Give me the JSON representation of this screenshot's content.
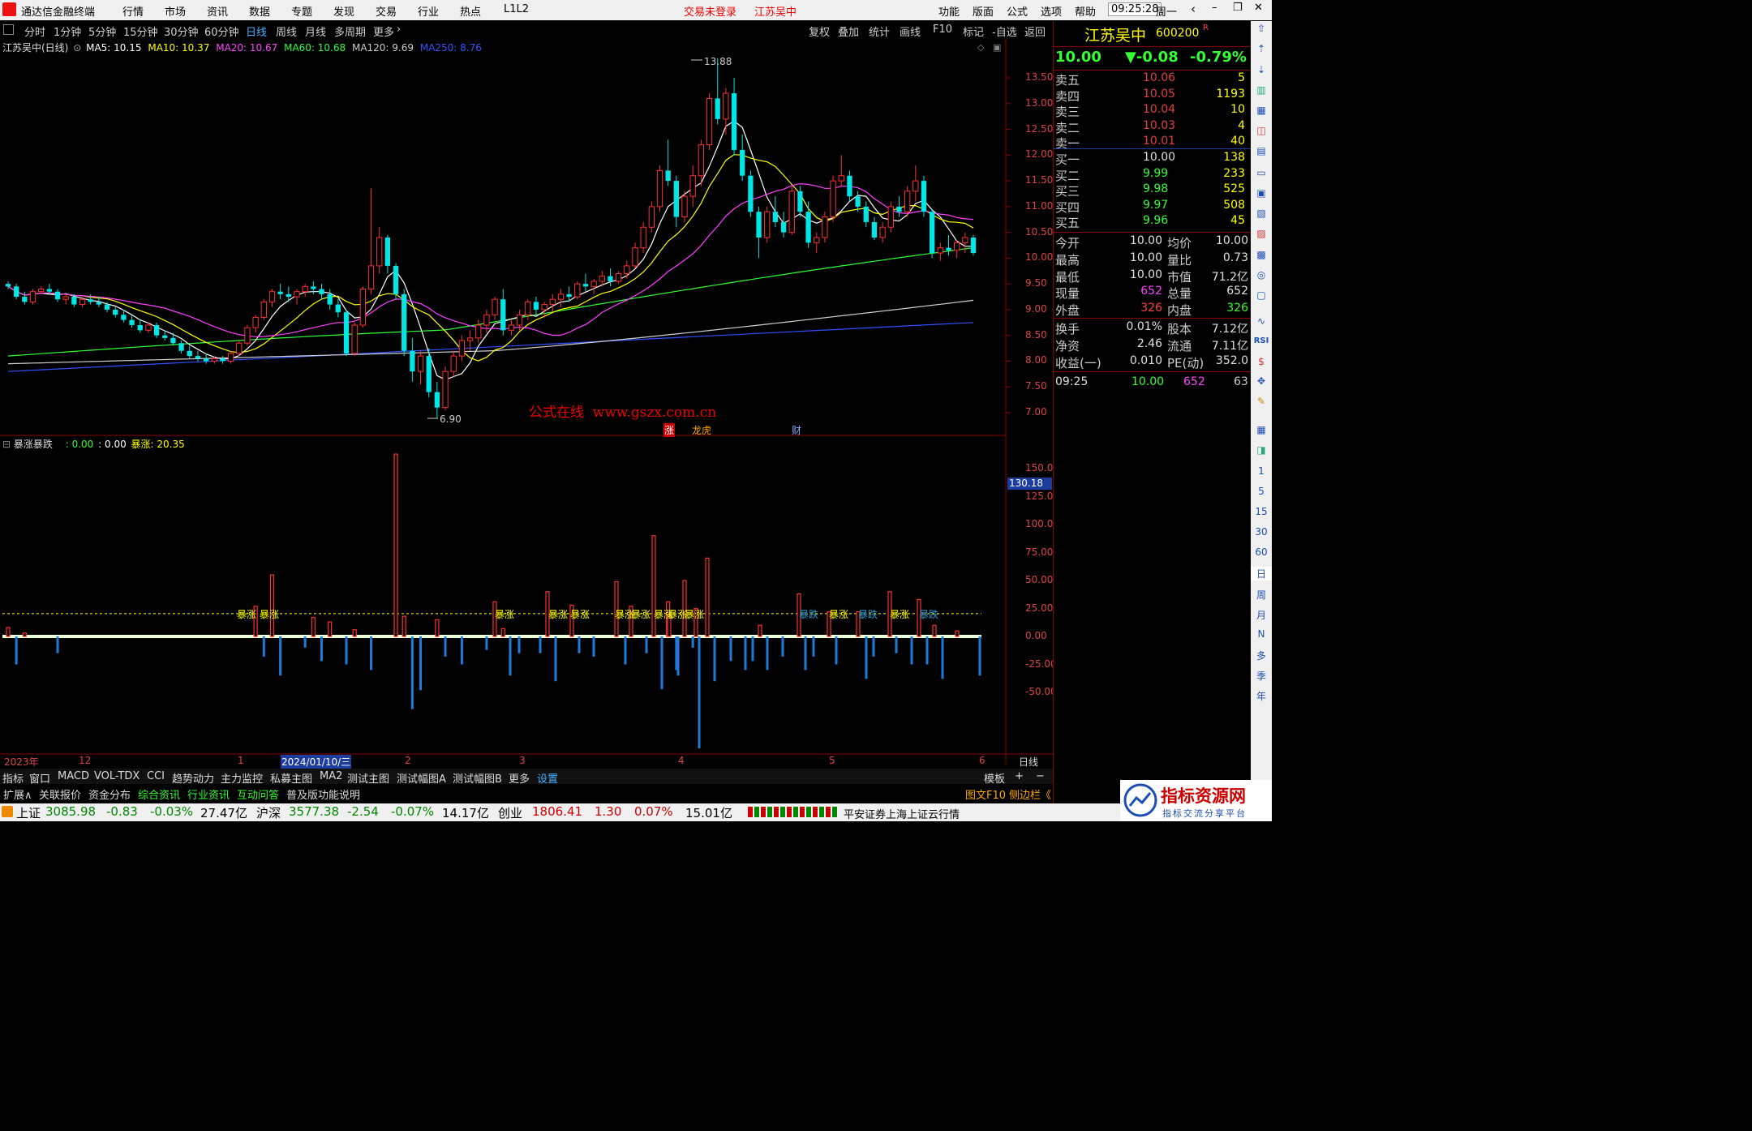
{
  "menubar": {
    "app_title": "通达信金融终端",
    "menus": [
      "行情",
      "市场",
      "资讯",
      "数据",
      "专题",
      "发现",
      "交易",
      "行业",
      "热点",
      "L1L2"
    ],
    "trade_status": "交易未登录",
    "stock_name": "江苏吴中",
    "right_menus": [
      "功能",
      "版面",
      "公式",
      "选项",
      "帮助"
    ],
    "time": "09:25:28",
    "weekday": "周一"
  },
  "period_tabs": [
    "分时",
    "1分钟",
    "5分钟",
    "15分钟",
    "30分钟",
    "60分钟",
    "日线",
    "周线",
    "月线",
    "多周期",
    "更多"
  ],
  "active_period": "日线",
  "chart_tools": [
    "复权",
    "叠加",
    "统计",
    "画线",
    "F10",
    "标记",
    "-自选",
    "返回"
  ],
  "ma_legend": {
    "title": "江苏吴中(日线)",
    "items": [
      {
        "label": "MA5: 10.15",
        "color": "#ffffff"
      },
      {
        "label": "MA10: 10.37",
        "color": "#ffff00"
      },
      {
        "label": "MA20: 10.67",
        "color": "#ff40ff"
      },
      {
        "label": "MA60: 10.68",
        "color": "#30ff30"
      },
      {
        "label": "MA120: 9.69",
        "color": "#d0d0d0"
      },
      {
        "label": "MA250: 8.76",
        "color": "#3050ff"
      }
    ]
  },
  "price_axis": [
    "13.50",
    "13.00",
    "12.50",
    "12.00",
    "11.50",
    "11.00",
    "10.50",
    "10.00",
    "9.50",
    "9.00",
    "8.50",
    "8.00",
    "7.50",
    "7.00"
  ],
  "high_label": "13.88",
  "low_label": "6.90",
  "watermark": "公式在线  www.gszx.com.cn",
  "event_tags": [
    "涨",
    "龙虎",
    "财"
  ],
  "indicator": {
    "name": "暴涨暴跌",
    "v1": ": 0.00",
    "v2": ": 0.00",
    "v3_label": "暴涨: 20.35",
    "axis": [
      "150.0",
      "125.0",
      "100.0",
      "75.00",
      "50.00",
      "25.00",
      "0.00",
      "-25.00",
      "-50.00"
    ],
    "current_tag": "130.18",
    "bar_labels": [
      "暴涨",
      "暴涨",
      "暴涨",
      "暴涨",
      "暴涨",
      "暴涨",
      "暴涨",
      "暴涨",
      "暴涨",
      "暴涨",
      "暴跌",
      "暴涨",
      "暴跌",
      "暴涨",
      "暴跌"
    ]
  },
  "date_axis": [
    "2023年",
    "12",
    "1",
    "2024/01/10/三",
    "2",
    "3",
    "4",
    "5",
    "6"
  ],
  "period_label": "日线",
  "indicator_tabs": [
    "指标",
    "窗口",
    "MACD",
    "VOL-TDX",
    "CCI",
    "趋势动力",
    "主力监控",
    "私募主图",
    "MA2",
    "测试主图",
    "测试幅图A",
    "测试幅图B",
    "更多",
    "设置"
  ],
  "template_tab": "模板",
  "bottom_tabs": [
    "扩展∧",
    "关联报价",
    "资金分布",
    "综合资讯",
    "行业资讯",
    "互动问答",
    "普及版功能说明"
  ],
  "bottom_right": [
    "图文F10",
    "侧边栏《",
    "笔",
    "价",
    "细"
  ],
  "quote": {
    "name": "江苏吴中",
    "code": "600200",
    "flag": "R",
    "price": "10.00",
    "change": "▼-0.08",
    "pct": "-0.79%",
    "asks": [
      {
        "label": "卖五",
        "price": "10.06",
        "vol": "5"
      },
      {
        "label": "卖四",
        "price": "10.05",
        "vol": "1193"
      },
      {
        "label": "卖三",
        "price": "10.04",
        "vol": "10"
      },
      {
        "label": "卖二",
        "price": "10.03",
        "vol": "4"
      },
      {
        "label": "卖一",
        "price": "10.01",
        "vol": "40"
      }
    ],
    "bids": [
      {
        "label": "买一",
        "price": "10.00",
        "vol": "138"
      },
      {
        "label": "买二",
        "price": "9.99",
        "vol": "233"
      },
      {
        "label": "买三",
        "price": "9.98",
        "vol": "525"
      },
      {
        "label": "买四",
        "price": "9.97",
        "vol": "508"
      },
      {
        "label": "买五",
        "price": "9.96",
        "vol": "45"
      }
    ],
    "stats": [
      {
        "l1": "今开",
        "v1": "10.00",
        "l2": "均价",
        "v2": "10.00",
        "c1": "#e0e0e0",
        "c2": "#e0e0e0"
      },
      {
        "l1": "最高",
        "v1": "10.00",
        "l2": "量比",
        "v2": "0.73",
        "c1": "#e0e0e0",
        "c2": "#e0e0e0"
      },
      {
        "l1": "最低",
        "v1": "10.00",
        "l2": "市值",
        "v2": "71.2亿",
        "c1": "#e0e0e0",
        "c2": "#e0e0e0"
      },
      {
        "l1": "现量",
        "v1": "652",
        "l2": "总量",
        "v2": "652",
        "c1": "#ff40ff",
        "c2": "#e0e0e0"
      },
      {
        "l1": "外盘",
        "v1": "326",
        "l2": "内盘",
        "v2": "326",
        "c1": "#ff4040",
        "c2": "#30ff30"
      }
    ],
    "fund": [
      {
        "l1": "换手",
        "v1": "0.01%",
        "l2": "股本",
        "v2": "7.12亿"
      },
      {
        "l1": "净资",
        "v1": "2.46",
        "l2": "流通",
        "v2": "7.11亿"
      },
      {
        "l1": "收益(一)",
        "v1": "0.010",
        "l2": "PE(动)",
        "v2": "352.0"
      }
    ],
    "tick": {
      "time": "09:25",
      "price": "10.00",
      "vol": "652",
      "num": "63"
    }
  },
  "side_toolbar": [
    "RSI",
    "1",
    "5",
    "15",
    "30",
    "60",
    "日",
    "周",
    "月",
    "N",
    "多",
    "季",
    "年"
  ],
  "statusbar": {
    "indices": [
      {
        "name": "上证",
        "value": "3085.98",
        "chg": "-0.83",
        "pct": "-0.03%",
        "amt": "27.47亿"
      },
      {
        "name": "沪深",
        "value": "3577.38",
        "chg": "-2.54",
        "pct": "-0.07%",
        "amt": "14.17亿"
      },
      {
        "name": "创业",
        "value": "1806.41",
        "chg": "1.30",
        "pct": "0.07%",
        "amt": "15.01亿"
      }
    ],
    "feed": "平安证券上海上证云行情",
    "logo_text": "指标资源网",
    "logo_sub": "指标交流分享平台"
  },
  "chart_data": {
    "type": "candlestick",
    "title": "江苏吴中(日线)",
    "ylim": [
      6.9,
      13.88
    ],
    "note": "approximate OHLC read from chart",
    "candles": [
      [
        9.5,
        9.55,
        9.4,
        9.45
      ],
      [
        9.45,
        9.5,
        9.2,
        9.25
      ],
      [
        9.25,
        9.35,
        9.1,
        9.15
      ],
      [
        9.15,
        9.4,
        9.1,
        9.35
      ],
      [
        9.35,
        9.45,
        9.3,
        9.4
      ],
      [
        9.4,
        9.5,
        9.3,
        9.35
      ],
      [
        9.35,
        9.4,
        9.15,
        9.2
      ],
      [
        9.2,
        9.3,
        9.1,
        9.25
      ],
      [
        9.25,
        9.3,
        9.05,
        9.1
      ],
      [
        9.1,
        9.25,
        9.05,
        9.2
      ],
      [
        9.2,
        9.3,
        9.1,
        9.15
      ],
      [
        9.15,
        9.25,
        9.05,
        9.1
      ],
      [
        9.1,
        9.15,
        8.95,
        9.0
      ],
      [
        9.0,
        9.05,
        8.85,
        8.9
      ],
      [
        8.9,
        9.0,
        8.75,
        8.8
      ],
      [
        8.8,
        8.9,
        8.65,
        8.7
      ],
      [
        8.7,
        8.8,
        8.55,
        8.6
      ],
      [
        8.6,
        8.75,
        8.55,
        8.7
      ],
      [
        8.7,
        8.75,
        8.45,
        8.5
      ],
      [
        8.5,
        8.6,
        8.4,
        8.45
      ],
      [
        8.45,
        8.55,
        8.3,
        8.35
      ],
      [
        8.35,
        8.4,
        8.15,
        8.2
      ],
      [
        8.2,
        8.3,
        8.05,
        8.1
      ],
      [
        8.1,
        8.2,
        8.0,
        8.05
      ],
      [
        8.05,
        8.15,
        7.95,
        8.0
      ],
      [
        8.0,
        8.1,
        7.95,
        8.05
      ],
      [
        8.05,
        8.1,
        7.95,
        8.0
      ],
      [
        8.0,
        8.2,
        7.95,
        8.15
      ],
      [
        8.15,
        8.4,
        8.1,
        8.35
      ],
      [
        8.35,
        8.7,
        8.3,
        8.65
      ],
      [
        8.65,
        8.9,
        8.55,
        8.85
      ],
      [
        8.85,
        9.2,
        8.8,
        9.15
      ],
      [
        9.15,
        9.4,
        9.05,
        9.35
      ],
      [
        9.35,
        9.5,
        9.2,
        9.3
      ],
      [
        9.3,
        9.45,
        9.15,
        9.25
      ],
      [
        9.25,
        9.4,
        9.1,
        9.35
      ],
      [
        9.35,
        9.5,
        9.25,
        9.45
      ],
      [
        9.45,
        9.55,
        9.3,
        9.4
      ],
      [
        9.4,
        9.5,
        9.2,
        9.3
      ],
      [
        9.3,
        9.4,
        9.0,
        9.1
      ],
      [
        9.1,
        9.2,
        8.85,
        8.95
      ],
      [
        8.95,
        9.0,
        8.1,
        8.15
      ],
      [
        8.15,
        8.75,
        8.1,
        8.7
      ],
      [
        8.7,
        9.45,
        8.65,
        9.4
      ],
      [
        9.4,
        11.35,
        9.3,
        9.85
      ],
      [
        9.85,
        10.6,
        9.7,
        10.4
      ],
      [
        10.4,
        10.45,
        9.7,
        9.85
      ],
      [
        9.85,
        9.9,
        9.2,
        9.3
      ],
      [
        9.3,
        9.4,
        8.1,
        8.2
      ],
      [
        8.2,
        8.45,
        7.6,
        7.8
      ],
      [
        7.8,
        8.2,
        7.55,
        8.1
      ],
      [
        8.1,
        8.25,
        7.3,
        7.4
      ],
      [
        7.4,
        7.6,
        6.9,
        7.1
      ],
      [
        7.1,
        7.9,
        7.05,
        7.8
      ],
      [
        7.8,
        8.2,
        7.7,
        8.1
      ],
      [
        8.1,
        8.5,
        8.0,
        8.4
      ],
      [
        8.4,
        8.6,
        8.2,
        8.45
      ],
      [
        8.45,
        8.8,
        8.35,
        8.7
      ],
      [
        8.7,
        9.0,
        8.55,
        8.9
      ],
      [
        8.9,
        9.25,
        8.8,
        9.2
      ],
      [
        9.2,
        9.4,
        8.5,
        8.6
      ],
      [
        8.6,
        8.8,
        8.5,
        8.7
      ],
      [
        8.7,
        9.0,
        8.6,
        8.9
      ],
      [
        8.9,
        9.2,
        8.8,
        9.15
      ],
      [
        9.15,
        9.25,
        8.9,
        9.0
      ],
      [
        9.0,
        9.15,
        8.85,
        9.1
      ],
      [
        9.1,
        9.3,
        8.95,
        9.2
      ],
      [
        9.2,
        9.4,
        9.05,
        9.3
      ],
      [
        9.3,
        9.45,
        9.15,
        9.25
      ],
      [
        9.25,
        9.55,
        9.2,
        9.5
      ],
      [
        9.5,
        9.7,
        9.35,
        9.45
      ],
      [
        9.45,
        9.6,
        9.3,
        9.55
      ],
      [
        9.55,
        9.75,
        9.45,
        9.65
      ],
      [
        9.65,
        9.8,
        9.45,
        9.55
      ],
      [
        9.55,
        9.75,
        9.5,
        9.7
      ],
      [
        9.7,
        9.95,
        9.6,
        9.85
      ],
      [
        9.85,
        10.3,
        9.8,
        10.2
      ],
      [
        10.2,
        10.7,
        10.1,
        10.6
      ],
      [
        10.6,
        11.1,
        10.5,
        11.0
      ],
      [
        11.0,
        11.8,
        10.9,
        11.7
      ],
      [
        11.7,
        12.3,
        11.4,
        11.5
      ],
      [
        11.5,
        11.6,
        10.6,
        10.8
      ],
      [
        10.8,
        11.3,
        10.7,
        11.2
      ],
      [
        11.2,
        11.8,
        11.0,
        11.6
      ],
      [
        11.6,
        12.3,
        11.4,
        12.2
      ],
      [
        12.2,
        13.2,
        12.1,
        13.1
      ],
      [
        13.1,
        13.88,
        12.6,
        12.7
      ],
      [
        12.7,
        13.3,
        12.4,
        13.2
      ],
      [
        13.2,
        13.5,
        12.0,
        12.1
      ],
      [
        12.1,
        12.4,
        11.5,
        11.6
      ],
      [
        11.6,
        11.7,
        10.8,
        10.9
      ],
      [
        10.9,
        11.0,
        10.0,
        10.4
      ],
      [
        10.4,
        11.0,
        10.3,
        10.9
      ],
      [
        10.9,
        11.2,
        10.6,
        10.7
      ],
      [
        10.7,
        10.9,
        10.4,
        10.5
      ],
      [
        10.5,
        11.4,
        10.45,
        11.3
      ],
      [
        11.3,
        11.4,
        10.8,
        10.9
      ],
      [
        10.9,
        11.1,
        10.2,
        10.3
      ],
      [
        10.3,
        10.5,
        10.1,
        10.4
      ],
      [
        10.4,
        10.9,
        10.3,
        10.8
      ],
      [
        10.8,
        11.6,
        10.7,
        11.5
      ],
      [
        11.5,
        12.0,
        11.4,
        11.6
      ],
      [
        11.6,
        11.7,
        11.1,
        11.2
      ],
      [
        11.2,
        11.3,
        10.9,
        11.0
      ],
      [
        11.0,
        11.1,
        10.6,
        10.7
      ],
      [
        10.7,
        10.8,
        10.35,
        10.4
      ],
      [
        10.4,
        10.7,
        10.3,
        10.6
      ],
      [
        10.6,
        11.1,
        10.5,
        11.0
      ],
      [
        11.0,
        11.2,
        10.8,
        10.9
      ],
      [
        10.9,
        11.4,
        10.8,
        11.3
      ],
      [
        11.3,
        11.8,
        11.1,
        11.5
      ],
      [
        11.5,
        11.6,
        10.8,
        10.9
      ],
      [
        10.9,
        10.95,
        10.0,
        10.1
      ],
      [
        10.1,
        10.3,
        9.95,
        10.2
      ],
      [
        10.2,
        10.45,
        10.05,
        10.15
      ],
      [
        10.15,
        10.35,
        10.0,
        10.3
      ],
      [
        10.3,
        10.5,
        10.1,
        10.4
      ],
      [
        10.4,
        10.45,
        10.05,
        10.1
      ]
    ],
    "ma_series": [
      "MA5",
      "MA10",
      "MA20",
      "MA60",
      "MA120",
      "MA250"
    ],
    "indicator_bars": {
      "name": "暴涨暴跌",
      "threshold": 20.35,
      "values": [
        8,
        -25,
        3,
        0,
        0,
        0,
        -15,
        0,
        0,
        0,
        0,
        0,
        0,
        0,
        0,
        0,
        0,
        0,
        0,
        0,
        0,
        0,
        0,
        0,
        0,
        0,
        0,
        0,
        0,
        0,
        27,
        -18,
        55,
        -35,
        0,
        0,
        -10,
        17,
        -22,
        13,
        0,
        -25,
        6,
        0,
        -30,
        0,
        0,
        163,
        18,
        -65,
        -48,
        0,
        15,
        -18,
        0,
        -25,
        0,
        0,
        -12,
        0,
        7,
        0,
        0,
        0,
        0,
        0,
        0,
        0,
        0,
        0,
        0,
        0,
        0,
        0,
        0,
        0,
        0,
        0,
        0,
        0,
        31,
        -30,
        0,
        -10,
        0,
        0,
        0,
        0,
        0,
        0,
        0,
        0,
        0,
        0,
        0,
        0,
        0,
        0,
        0,
        0,
        0,
        0,
        0,
        0,
        0,
        0,
        0,
        0
      ]
    }
  }
}
